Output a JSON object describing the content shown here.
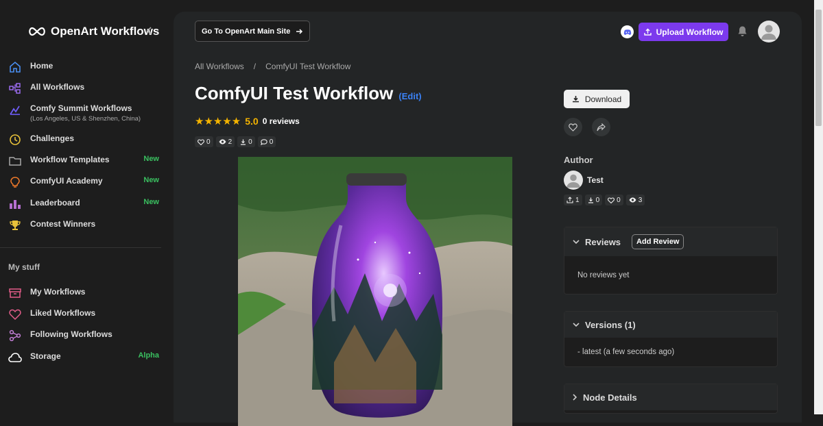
{
  "app": {
    "name": "OpenArt Workflows"
  },
  "sidebar": {
    "items": [
      {
        "label": "Home",
        "icon": "home-icon"
      },
      {
        "label": "All Workflows",
        "icon": "workflow-icon"
      },
      {
        "label": "Comfy Summit Workflows",
        "sub": "(Los Angeles, US & Shenzhen, China)",
        "icon": "chart-icon"
      },
      {
        "label": "Challenges",
        "icon": "clock-icon"
      },
      {
        "label": "Workflow Templates",
        "tag": "New",
        "icon": "folder-icon"
      },
      {
        "label": "ComfyUI Academy",
        "tag": "New",
        "icon": "bulb-icon"
      },
      {
        "label": "Leaderboard",
        "tag": "New",
        "icon": "bar-chart-icon"
      },
      {
        "label": "Contest Winners",
        "icon": "trophy-icon"
      }
    ],
    "section_title": "My stuff",
    "my_items": [
      {
        "label": "My Workflows",
        "icon": "archive-icon"
      },
      {
        "label": "Liked Workflows",
        "icon": "heart-icon"
      },
      {
        "label": "Following Workflows",
        "icon": "nodes-icon"
      },
      {
        "label": "Storage",
        "tag": "Alpha",
        "icon": "cloud-icon"
      }
    ]
  },
  "header": {
    "goto_label": "Go To OpenArt Main Site",
    "upload_label": "Upload Workflow"
  },
  "breadcrumb": {
    "root": "All Workflows",
    "sep": "/",
    "current": "ComfyUI Test Workflow"
  },
  "workflow": {
    "title": "ComfyUI Test Workflow",
    "edit_label": "(Edit)",
    "stars": "★★★★★",
    "rating": "5.0",
    "reviews": "0 reviews",
    "stats": {
      "likes": "0",
      "views": "2",
      "downloads": "0",
      "comments": "0"
    }
  },
  "actions": {
    "download_label": "Download"
  },
  "author": {
    "heading": "Author",
    "name": "Test",
    "stats": {
      "uploads": "1",
      "downloads": "0",
      "likes": "0",
      "views": "3"
    }
  },
  "reviews": {
    "title": "Reviews",
    "add_label": "Add Review",
    "empty": "No reviews yet"
  },
  "versions": {
    "title": "Versions (1)",
    "items": [
      "- latest (a few seconds ago)"
    ]
  },
  "node_details": {
    "title": "Node Details"
  },
  "colors": {
    "accent": "#7c3aed",
    "new_tag": "#3ac060",
    "star": "#f5b400",
    "link": "#3b82f6"
  }
}
